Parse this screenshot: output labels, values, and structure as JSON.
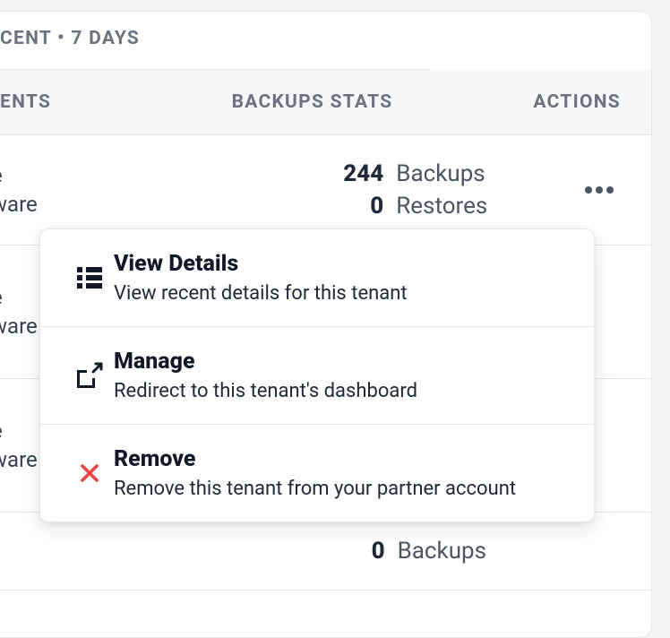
{
  "header": {
    "title": "CENT • 7 DAYS"
  },
  "columns": {
    "events": "ENTS",
    "stats": "BACKUPS STATS",
    "actions": "ACTIONS"
  },
  "rows": [
    {
      "events_line1": "e",
      "events_line2": "ware",
      "stats": [
        {
          "value": "244",
          "label": "Backups"
        },
        {
          "value": "0",
          "label": "Restores"
        }
      ]
    },
    {
      "events_line1": "e",
      "events_line2": "ware",
      "stats": []
    },
    {
      "events_line1": "e",
      "events_line2": "ware",
      "stats": []
    },
    {
      "events_line1": "",
      "events_line2": "",
      "stats": [
        {
          "value": "0",
          "label": "Backups"
        }
      ]
    }
  ],
  "dropdown": {
    "items": [
      {
        "title": "View Details",
        "desc": "View recent details for this tenant"
      },
      {
        "title": "Manage",
        "desc": "Redirect to this tenant's dashboard"
      },
      {
        "title": "Remove",
        "desc": "Remove this tenant from your partner account"
      }
    ]
  },
  "colors": {
    "danger": "#ef4444"
  }
}
